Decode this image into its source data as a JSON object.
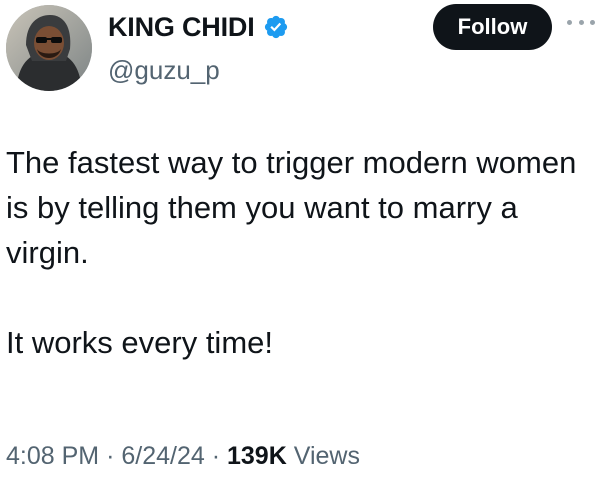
{
  "author": {
    "display_name": "KING CHIDI",
    "handle": "@guzu_p",
    "verified": true,
    "verified_color": "#1d9bf0"
  },
  "actions": {
    "follow_label": "Follow",
    "more_icon": "more-horizontal-icon"
  },
  "tweet": {
    "paragraph_1": "The fastest way to trigger modern women is by telling them you want to marry a virgin.",
    "paragraph_2": "It works every time!"
  },
  "meta": {
    "time": "4:08 PM",
    "separator": "·",
    "date": "6/24/24",
    "views_count": "139K",
    "views_label": "Views"
  }
}
